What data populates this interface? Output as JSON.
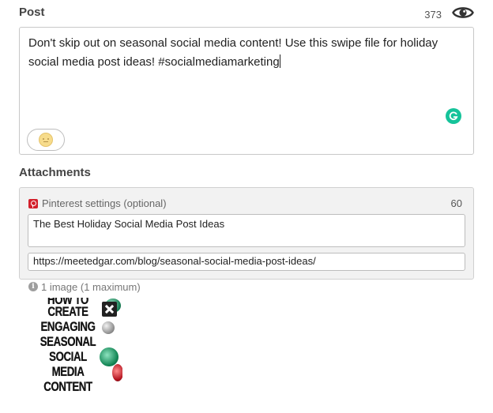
{
  "post": {
    "label": "Post",
    "char_count": "373",
    "text": "Don't skip out on seasonal social media content! Use this swipe file for holiday social media post ideas! #socialmediamarketing",
    "icons": {
      "preview": "eye-icon",
      "grammar_checker": "grammarly-icon",
      "emoji_picker": "smiley-emoji-icon"
    }
  },
  "attachments": {
    "label": "Attachments",
    "pinterest": {
      "label": "Pinterest settings (optional)",
      "char_count": "60",
      "icon": "pinterest-icon",
      "pin_title": "The Best Holiday Social Media Post Ideas",
      "pin_url": "https://meetedgar.com/blog/seasonal-social-media-post-ideas/"
    },
    "images": {
      "info_text": "1 image (1 maximum)",
      "thumbnail_lines": [
        "HOW TO",
        "CREATE",
        "ENGAGING",
        "SEASONAL",
        "SOCIAL",
        "MEDIA",
        "CONTENT"
      ]
    }
  },
  "colors": {
    "grammarly": "#15c39a",
    "pinterest": "#d3212c",
    "panel_background": "#f2f2f2",
    "border": "#c8c8c8"
  }
}
